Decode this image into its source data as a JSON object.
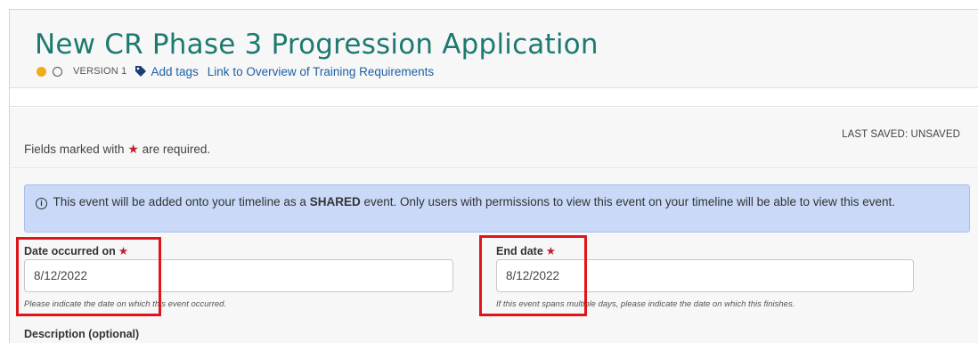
{
  "page": {
    "title": "New CR Phase 3 Progression Application",
    "version_label": "VERSION 1",
    "add_tags_label": "Add tags",
    "overview_link_label": "Link to Overview of Training Requirements"
  },
  "form_header": {
    "required_note_before": "Fields marked with",
    "required_note_after": "are required.",
    "required_star": "★",
    "last_saved": "LAST SAVED: UNSAVED"
  },
  "info_banner": {
    "icon": "info-icon",
    "text_before": "This event will be added onto your timeline as a",
    "text_bold": "SHARED",
    "text_after": "event. Only users with permissions to view this event on your timeline will be able to view this event."
  },
  "fields": {
    "date_occurred": {
      "label": "Date occurred on",
      "value": "8/12/2022",
      "help": "Please indicate the date on which this event occurred."
    },
    "end_date": {
      "label": "End date",
      "value": "8/12/2022",
      "help": "If this event spans multiple days, please indicate the date on which this finishes."
    },
    "description": {
      "label": "Description (optional)"
    }
  },
  "colors": {
    "title": "#1d7a72",
    "status_dot": "#f0ad18",
    "link": "#1b5fa5",
    "required_star": "#c0202a",
    "info_background": "#c9d9f7",
    "highlight": "#e0151c"
  }
}
